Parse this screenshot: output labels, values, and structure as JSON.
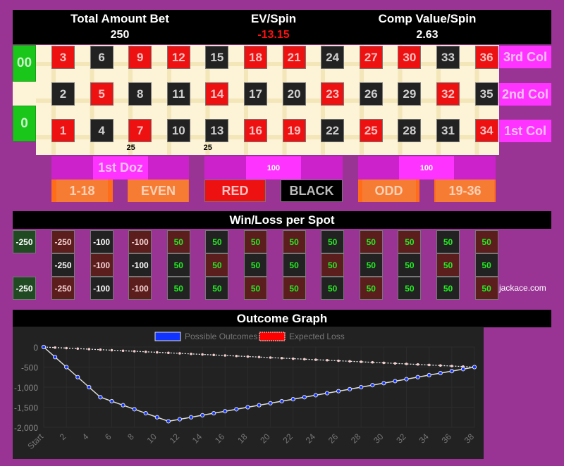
{
  "header": {
    "total_bet_label": "Total Amount Bet",
    "total_bet_value": "250",
    "ev_label": "EV/Spin",
    "ev_value": "-13.15",
    "comp_label": "Comp Value/Spin",
    "comp_value": "2.63"
  },
  "colors": {
    "background": "#993495",
    "red": "#ee1111",
    "black": "#222222",
    "green": "#1bc61b",
    "magenta": "#ff33ff",
    "orange": "#ff6d1a",
    "ev_negative": "#ff1111"
  },
  "zeros": [
    "00",
    "0"
  ],
  "grid": {
    "rows": [
      [
        {
          "n": "3",
          "c": "red"
        },
        {
          "n": "6",
          "c": "black"
        },
        {
          "n": "9",
          "c": "red"
        },
        {
          "n": "12",
          "c": "red"
        },
        {
          "n": "15",
          "c": "black"
        },
        {
          "n": "18",
          "c": "red"
        },
        {
          "n": "21",
          "c": "red"
        },
        {
          "n": "24",
          "c": "black"
        },
        {
          "n": "27",
          "c": "red"
        },
        {
          "n": "30",
          "c": "red"
        },
        {
          "n": "33",
          "c": "black"
        },
        {
          "n": "36",
          "c": "red"
        }
      ],
      [
        {
          "n": "2",
          "c": "black"
        },
        {
          "n": "5",
          "c": "red"
        },
        {
          "n": "8",
          "c": "black"
        },
        {
          "n": "11",
          "c": "black"
        },
        {
          "n": "14",
          "c": "red"
        },
        {
          "n": "17",
          "c": "black"
        },
        {
          "n": "20",
          "c": "black"
        },
        {
          "n": "23",
          "c": "red"
        },
        {
          "n": "26",
          "c": "black"
        },
        {
          "n": "29",
          "c": "black"
        },
        {
          "n": "32",
          "c": "red"
        },
        {
          "n": "35",
          "c": "black"
        }
      ],
      [
        {
          "n": "1",
          "c": "red"
        },
        {
          "n": "4",
          "c": "black"
        },
        {
          "n": "7",
          "c": "red"
        },
        {
          "n": "10",
          "c": "black"
        },
        {
          "n": "13",
          "c": "black"
        },
        {
          "n": "16",
          "c": "red"
        },
        {
          "n": "19",
          "c": "red"
        },
        {
          "n": "22",
          "c": "black"
        },
        {
          "n": "25",
          "c": "red"
        },
        {
          "n": "28",
          "c": "black"
        },
        {
          "n": "31",
          "c": "black"
        },
        {
          "n": "34",
          "c": "red"
        }
      ]
    ],
    "chips": [
      {
        "after_index": 1,
        "amount": "25"
      },
      {
        "after_index": 3,
        "amount": "25"
      }
    ]
  },
  "columns": [
    "3rd Col",
    "2nd Col",
    "1st Col"
  ],
  "dozens": [
    "1st Doz",
    "100",
    "100"
  ],
  "outside": [
    "1-18",
    "EVEN",
    "RED",
    "BLACK",
    "ODD",
    "19-36"
  ],
  "winloss": {
    "title": "Win/Loss per Spot",
    "zeros": [
      "-250",
      "-250"
    ],
    "rows": [
      [
        {
          "v": "-250",
          "c": "red"
        },
        {
          "v": "-100",
          "c": "black"
        },
        {
          "v": "-100",
          "c": "red"
        },
        {
          "v": "50",
          "c": "red"
        },
        {
          "v": "50",
          "c": "black"
        },
        {
          "v": "50",
          "c": "red"
        },
        {
          "v": "50",
          "c": "red"
        },
        {
          "v": "50",
          "c": "black"
        },
        {
          "v": "50",
          "c": "red"
        },
        {
          "v": "50",
          "c": "red"
        },
        {
          "v": "50",
          "c": "black"
        },
        {
          "v": "50",
          "c": "red"
        }
      ],
      [
        {
          "v": "-250",
          "c": "black"
        },
        {
          "v": "-100",
          "c": "red"
        },
        {
          "v": "-100",
          "c": "black"
        },
        {
          "v": "50",
          "c": "black"
        },
        {
          "v": "50",
          "c": "red"
        },
        {
          "v": "50",
          "c": "black"
        },
        {
          "v": "50",
          "c": "black"
        },
        {
          "v": "50",
          "c": "red"
        },
        {
          "v": "50",
          "c": "black"
        },
        {
          "v": "50",
          "c": "black"
        },
        {
          "v": "50",
          "c": "red"
        },
        {
          "v": "50",
          "c": "black"
        }
      ],
      [
        {
          "v": "-250",
          "c": "red"
        },
        {
          "v": "-100",
          "c": "black"
        },
        {
          "v": "-100",
          "c": "red"
        },
        {
          "v": "50",
          "c": "black"
        },
        {
          "v": "50",
          "c": "black"
        },
        {
          "v": "50",
          "c": "red"
        },
        {
          "v": "50",
          "c": "red"
        },
        {
          "v": "50",
          "c": "black"
        },
        {
          "v": "50",
          "c": "red"
        },
        {
          "v": "50",
          "c": "black"
        },
        {
          "v": "50",
          "c": "black"
        },
        {
          "v": "50",
          "c": "red"
        }
      ]
    ]
  },
  "brand": "jackace.com",
  "chart_data": {
    "type": "line",
    "title": "Outcome Graph",
    "xlabel": "",
    "ylabel": "",
    "x": [
      0,
      1,
      2,
      3,
      4,
      5,
      6,
      7,
      8,
      9,
      10,
      11,
      12,
      13,
      14,
      15,
      16,
      17,
      18,
      19,
      20,
      21,
      22,
      23,
      24,
      25,
      26,
      27,
      28,
      29,
      30,
      31,
      32,
      33,
      34,
      35,
      36,
      37,
      38
    ],
    "x_tick_labels": [
      "Start",
      "2",
      "4",
      "6",
      "8",
      "10",
      "12",
      "14",
      "16",
      "18",
      "20",
      "22",
      "24",
      "26",
      "28",
      "30",
      "32",
      "34",
      "36",
      "38"
    ],
    "y_tick_labels": [
      "0",
      "-500",
      "-1,000",
      "-1,500",
      "-2,000"
    ],
    "ylim": [
      -2000,
      0
    ],
    "xlim": [
      0,
      38
    ],
    "grid": true,
    "legend": "top-center",
    "series": [
      {
        "name": "Possible Outcomes",
        "color": "#1133ff",
        "style": "solid",
        "values": [
          0,
          -250,
          -500,
          -750,
          -1000,
          -1250,
          -1350,
          -1450,
          -1550,
          -1650,
          -1750,
          -1850,
          -1800,
          -1750,
          -1700,
          -1650,
          -1600,
          -1550,
          -1500,
          -1450,
          -1400,
          -1350,
          -1300,
          -1250,
          -1200,
          -1150,
          -1100,
          -1050,
          -1000,
          -950,
          -900,
          -850,
          -800,
          -750,
          -700,
          -650,
          -600,
          -550,
          -500
        ]
      },
      {
        "name": "Expected Loss",
        "color": "#ff0000",
        "style": "dotted",
        "values": [
          0,
          -13.15,
          -26.3,
          -39.45,
          -52.6,
          -65.75,
          -78.9,
          -92.05,
          -105.2,
          -118.35,
          -131.5,
          -144.65,
          -157.8,
          -170.95,
          -184.1,
          -197.25,
          -210.4,
          -223.55,
          -236.7,
          -249.85,
          -263,
          -276.15,
          -289.3,
          -302.45,
          -315.6,
          -328.75,
          -341.9,
          -355.05,
          -368.2,
          -381.35,
          -394.5,
          -407.65,
          -420.8,
          -433.95,
          -447.1,
          -460.25,
          -473.4,
          -486.55,
          -499.7
        ]
      }
    ]
  }
}
